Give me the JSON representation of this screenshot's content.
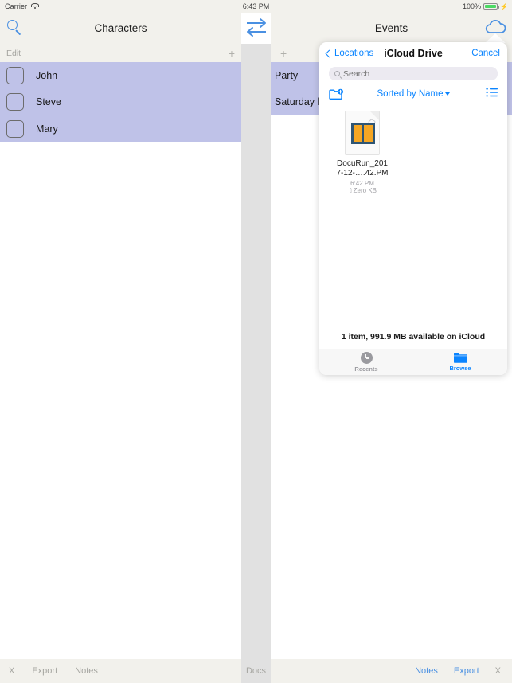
{
  "status_bar": {
    "carrier": "Carrier",
    "wifi_icon": "wifi-icon",
    "time": "6:43 PM",
    "battery_percent": "100%",
    "battery_color": "#4cd964",
    "charging_icon": "lightning-bolt-icon"
  },
  "left_panel": {
    "nav": {
      "title": "Characters",
      "search_icon": "search-icon"
    },
    "edit_label": "Edit",
    "add_label": "+",
    "row_background": "#bfc2e8",
    "rows": [
      {
        "label": "John",
        "checkbox_icon": "checkbox-unchecked-icon"
      },
      {
        "label": "Steve",
        "checkbox_icon": "checkbox-unchecked-icon"
      },
      {
        "label": "Mary",
        "checkbox_icon": "checkbox-unchecked-icon"
      }
    ],
    "toolbar": [
      {
        "label": "X",
        "name": "close-button"
      },
      {
        "label": "Export",
        "name": "export-button"
      },
      {
        "label": "Notes",
        "name": "notes-button"
      }
    ]
  },
  "divider": {
    "handle_icon": "drag-handle-divider",
    "docs_label": "Docs"
  },
  "right_panel": {
    "nav": {
      "title": "Events",
      "swap_icon": "swap-arrows-icon",
      "cloud_icon": "cloud-icon"
    },
    "add_label": "+",
    "rows": [
      {
        "label": "Party"
      },
      {
        "label": "Saturday lu"
      }
    ],
    "toolbar": [
      {
        "label": "Notes",
        "name": "notes-button",
        "color": "#4a90e2"
      },
      {
        "label": "Export",
        "name": "export-button",
        "color": "#4a90e2"
      },
      {
        "label": "X",
        "name": "close-button",
        "color": "#a5a5a0"
      }
    ]
  },
  "document_picker": {
    "back_label": "Locations",
    "back_icon": "chevron-left-icon",
    "title": "iCloud Drive",
    "cancel_label": "Cancel",
    "search": {
      "placeholder": "Search",
      "value": "",
      "icon": "search-icon"
    },
    "toolbar": {
      "new_folder_icon": "new-folder-icon",
      "sort_label": "Sorted by Name",
      "sort_caret_icon": "chevron-down-icon",
      "list_view_icon": "list-view-icon"
    },
    "files": [
      {
        "name": "DocuRun_2017-12-…..42.PM",
        "name_line1": "DocuRun_201",
        "name_line2": "7-12-….42.PM",
        "time": "6:42 PM",
        "size": "⇧Zero KB",
        "icon": "document-file-icon",
        "cloud_badge_icon": "cloud-icon",
        "icon_colors": {
          "frame": "#2f5573",
          "pages": "#f5a623"
        }
      }
    ],
    "status_text": "1 item, 991.9 MB available on iCloud",
    "tabs": [
      {
        "label": "Recents",
        "icon": "clock-icon",
        "selected": false
      },
      {
        "label": "Browse",
        "icon": "folder-icon",
        "selected": true
      }
    ],
    "accent_color": "#0a84ff"
  }
}
